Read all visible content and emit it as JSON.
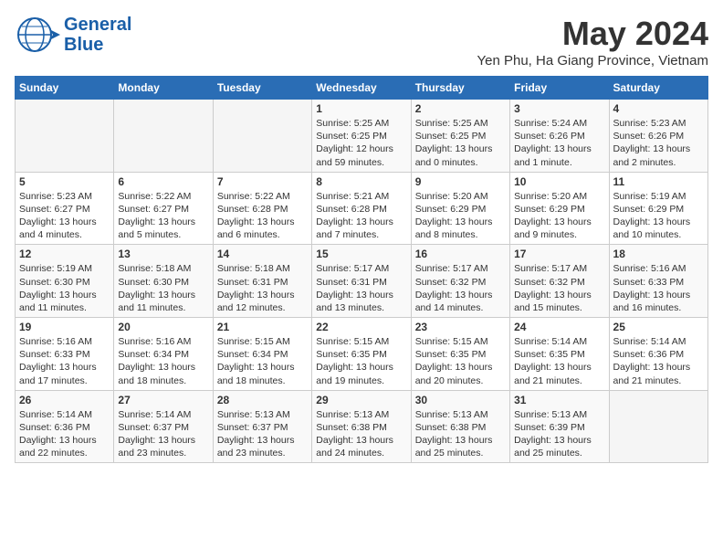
{
  "app": {
    "logo_line1": "General",
    "logo_line2": "Blue",
    "title": "May 2024",
    "subtitle": "Yen Phu, Ha Giang Province, Vietnam"
  },
  "calendar": {
    "headers": [
      "Sunday",
      "Monday",
      "Tuesday",
      "Wednesday",
      "Thursday",
      "Friday",
      "Saturday"
    ],
    "weeks": [
      [
        {
          "day": "",
          "info": ""
        },
        {
          "day": "",
          "info": ""
        },
        {
          "day": "",
          "info": ""
        },
        {
          "day": "1",
          "info": "Sunrise: 5:25 AM\nSunset: 6:25 PM\nDaylight: 12 hours and 59 minutes."
        },
        {
          "day": "2",
          "info": "Sunrise: 5:25 AM\nSunset: 6:25 PM\nDaylight: 13 hours and 0 minutes."
        },
        {
          "day": "3",
          "info": "Sunrise: 5:24 AM\nSunset: 6:26 PM\nDaylight: 13 hours and 1 minute."
        },
        {
          "day": "4",
          "info": "Sunrise: 5:23 AM\nSunset: 6:26 PM\nDaylight: 13 hours and 2 minutes."
        }
      ],
      [
        {
          "day": "5",
          "info": "Sunrise: 5:23 AM\nSunset: 6:27 PM\nDaylight: 13 hours and 4 minutes."
        },
        {
          "day": "6",
          "info": "Sunrise: 5:22 AM\nSunset: 6:27 PM\nDaylight: 13 hours and 5 minutes."
        },
        {
          "day": "7",
          "info": "Sunrise: 5:22 AM\nSunset: 6:28 PM\nDaylight: 13 hours and 6 minutes."
        },
        {
          "day": "8",
          "info": "Sunrise: 5:21 AM\nSunset: 6:28 PM\nDaylight: 13 hours and 7 minutes."
        },
        {
          "day": "9",
          "info": "Sunrise: 5:20 AM\nSunset: 6:29 PM\nDaylight: 13 hours and 8 minutes."
        },
        {
          "day": "10",
          "info": "Sunrise: 5:20 AM\nSunset: 6:29 PM\nDaylight: 13 hours and 9 minutes."
        },
        {
          "day": "11",
          "info": "Sunrise: 5:19 AM\nSunset: 6:29 PM\nDaylight: 13 hours and 10 minutes."
        }
      ],
      [
        {
          "day": "12",
          "info": "Sunrise: 5:19 AM\nSunset: 6:30 PM\nDaylight: 13 hours and 11 minutes."
        },
        {
          "day": "13",
          "info": "Sunrise: 5:18 AM\nSunset: 6:30 PM\nDaylight: 13 hours and 11 minutes."
        },
        {
          "day": "14",
          "info": "Sunrise: 5:18 AM\nSunset: 6:31 PM\nDaylight: 13 hours and 12 minutes."
        },
        {
          "day": "15",
          "info": "Sunrise: 5:17 AM\nSunset: 6:31 PM\nDaylight: 13 hours and 13 minutes."
        },
        {
          "day": "16",
          "info": "Sunrise: 5:17 AM\nSunset: 6:32 PM\nDaylight: 13 hours and 14 minutes."
        },
        {
          "day": "17",
          "info": "Sunrise: 5:17 AM\nSunset: 6:32 PM\nDaylight: 13 hours and 15 minutes."
        },
        {
          "day": "18",
          "info": "Sunrise: 5:16 AM\nSunset: 6:33 PM\nDaylight: 13 hours and 16 minutes."
        }
      ],
      [
        {
          "day": "19",
          "info": "Sunrise: 5:16 AM\nSunset: 6:33 PM\nDaylight: 13 hours and 17 minutes."
        },
        {
          "day": "20",
          "info": "Sunrise: 5:16 AM\nSunset: 6:34 PM\nDaylight: 13 hours and 18 minutes."
        },
        {
          "day": "21",
          "info": "Sunrise: 5:15 AM\nSunset: 6:34 PM\nDaylight: 13 hours and 18 minutes."
        },
        {
          "day": "22",
          "info": "Sunrise: 5:15 AM\nSunset: 6:35 PM\nDaylight: 13 hours and 19 minutes."
        },
        {
          "day": "23",
          "info": "Sunrise: 5:15 AM\nSunset: 6:35 PM\nDaylight: 13 hours and 20 minutes."
        },
        {
          "day": "24",
          "info": "Sunrise: 5:14 AM\nSunset: 6:35 PM\nDaylight: 13 hours and 21 minutes."
        },
        {
          "day": "25",
          "info": "Sunrise: 5:14 AM\nSunset: 6:36 PM\nDaylight: 13 hours and 21 minutes."
        }
      ],
      [
        {
          "day": "26",
          "info": "Sunrise: 5:14 AM\nSunset: 6:36 PM\nDaylight: 13 hours and 22 minutes."
        },
        {
          "day": "27",
          "info": "Sunrise: 5:14 AM\nSunset: 6:37 PM\nDaylight: 13 hours and 23 minutes."
        },
        {
          "day": "28",
          "info": "Sunrise: 5:13 AM\nSunset: 6:37 PM\nDaylight: 13 hours and 23 minutes."
        },
        {
          "day": "29",
          "info": "Sunrise: 5:13 AM\nSunset: 6:38 PM\nDaylight: 13 hours and 24 minutes."
        },
        {
          "day": "30",
          "info": "Sunrise: 5:13 AM\nSunset: 6:38 PM\nDaylight: 13 hours and 25 minutes."
        },
        {
          "day": "31",
          "info": "Sunrise: 5:13 AM\nSunset: 6:39 PM\nDaylight: 13 hours and 25 minutes."
        },
        {
          "day": "",
          "info": ""
        }
      ]
    ]
  }
}
